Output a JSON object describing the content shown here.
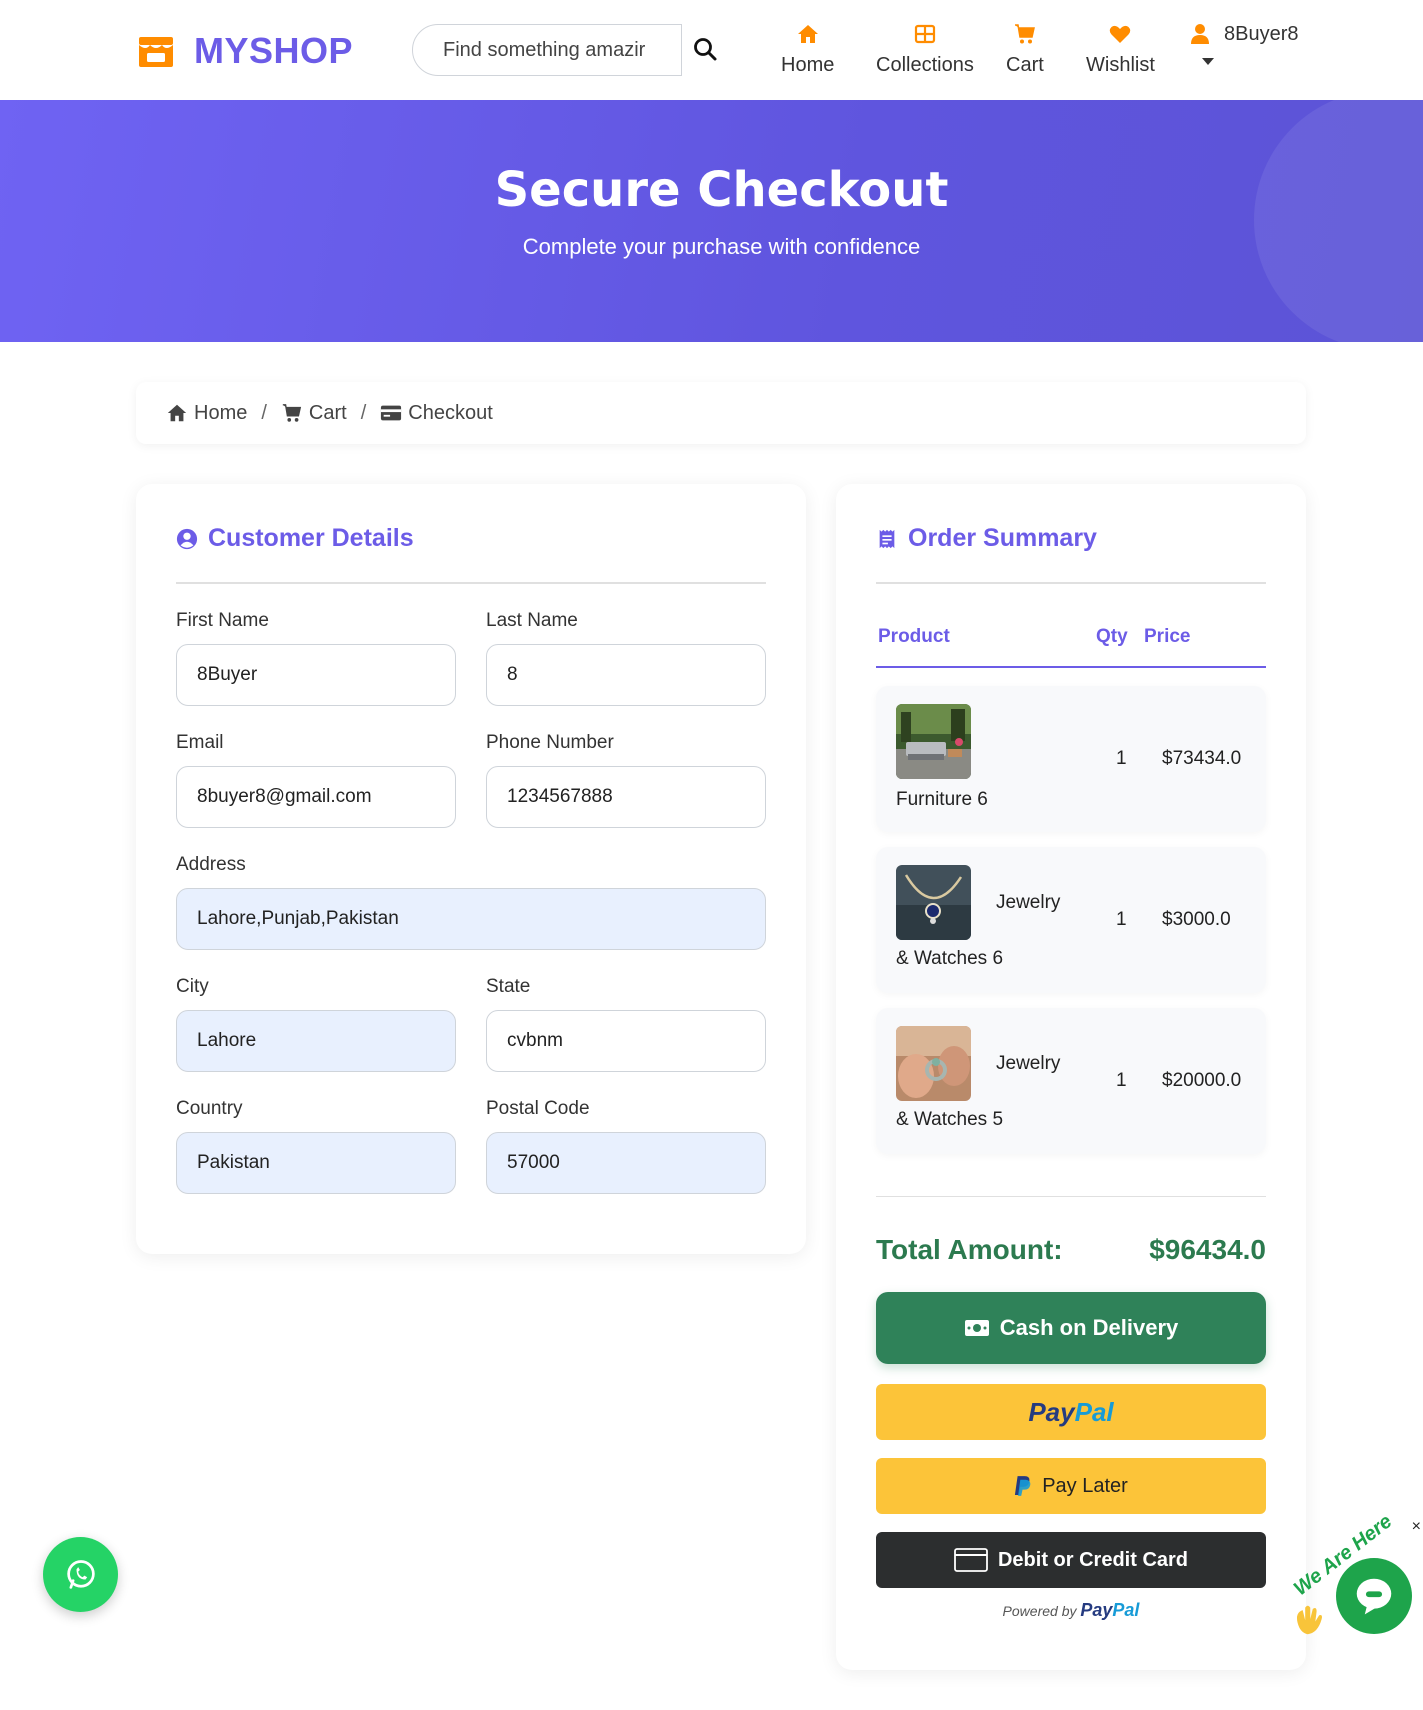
{
  "brand": {
    "name": "MYSHOP",
    "icon": "store-icon",
    "color": "#6c5ce7",
    "icon_color": "#ff8c00"
  },
  "search": {
    "placeholder": "Find something amazing...",
    "display": "Find something amazir"
  },
  "nav": {
    "items": [
      {
        "label": "Home",
        "icon": "home-icon"
      },
      {
        "label": "Collections",
        "icon": "grid-icon"
      },
      {
        "label": "Cart",
        "icon": "cart-icon"
      },
      {
        "label": "Wishlist",
        "icon": "heart-icon"
      }
    ],
    "user": {
      "label": "8Buyer8",
      "icon": "user-icon"
    }
  },
  "hero": {
    "title": "Secure Checkout",
    "subtitle": "Complete your purchase with confidence"
  },
  "breadcrumb": {
    "items": [
      {
        "label": "Home",
        "icon": "home-icon"
      },
      {
        "label": "Cart",
        "icon": "cart-icon"
      },
      {
        "label": "Checkout",
        "icon": "credit-card-icon"
      }
    ],
    "separator": "/"
  },
  "customer": {
    "title": "Customer Details",
    "fields": {
      "first_name": {
        "label": "First Name",
        "value": "8Buyer"
      },
      "last_name": {
        "label": "Last Name",
        "value": "8"
      },
      "email": {
        "label": "Email",
        "value": "8buyer8@gmail.com"
      },
      "phone": {
        "label": "Phone Number",
        "value": "1234567888"
      },
      "address": {
        "label": "Address",
        "value": "Lahore,Punjab,Pakistan"
      },
      "city": {
        "label": "City",
        "value": "Lahore"
      },
      "state": {
        "label": "State",
        "value": "cvbnm"
      },
      "country": {
        "label": "Country",
        "value": "Pakistan"
      },
      "postal": {
        "label": "Postal Code",
        "value": "57000"
      }
    }
  },
  "order": {
    "title": "Order Summary",
    "columns": {
      "product": "Product",
      "qty": "Qty",
      "price": "Price"
    },
    "items": [
      {
        "name": "Furniture 6",
        "name_line1": "",
        "name_line2": "Furniture 6",
        "qty": "1",
        "price": "$73434.0"
      },
      {
        "name": "Jewelry & Watches 6",
        "name_line1": "Jewelry",
        "name_line2": "& Watches 6",
        "qty": "1",
        "price": "$3000.0"
      },
      {
        "name": "Jewelry & Watches 5",
        "name_line1": "Jewelry",
        "name_line2": "& Watches 5",
        "qty": "1",
        "price": "$20000.0"
      }
    ],
    "total_label": "Total Amount:",
    "total_value": "$96434.0",
    "total_color": "#2c7a4f",
    "buttons": {
      "cod": "Cash on Delivery",
      "paypal_a": "Pay",
      "paypal_b": "Pal",
      "paylater": "Pay Later",
      "card": "Debit or Credit Card"
    },
    "powered_by": "Powered by",
    "powered_brand_a": "Pay",
    "powered_brand_b": "Pal"
  },
  "floating": {
    "whatsapp_icon": "whatsapp-icon",
    "chat_text": "We Are Here",
    "chat_close": "×"
  }
}
